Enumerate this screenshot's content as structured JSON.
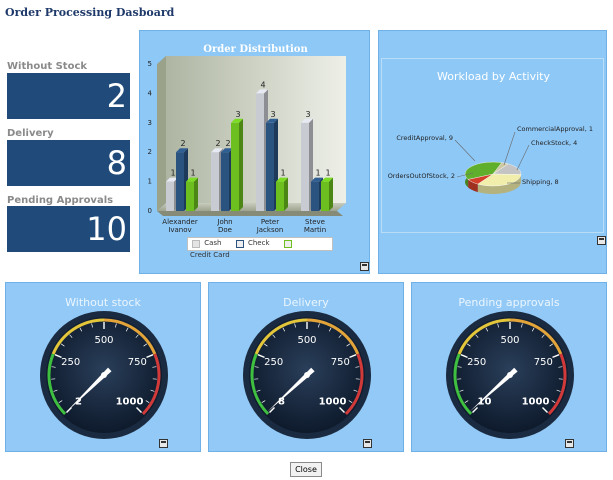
{
  "page": {
    "title": "Order Processing Dasboard"
  },
  "kpis": [
    {
      "label": "Without Stock",
      "value": "2"
    },
    {
      "label": "Delivery",
      "value": "8"
    },
    {
      "label": "Pending Approvals",
      "value": "10"
    }
  ],
  "chart_data": [
    {
      "type": "bar",
      "title": "Order Distribution",
      "categories": [
        "Alexander Ivanov",
        "John Doe",
        "Peter Jackson",
        "Steve Martin"
      ],
      "series": [
        {
          "name": "Cash",
          "values": [
            1,
            2,
            4,
            3
          ],
          "color": "#c9cbd3"
        },
        {
          "name": "Check",
          "values": [
            2,
            2,
            3,
            1
          ],
          "color": "#2a5380"
        },
        {
          "name": "Credit Card",
          "values": [
            1,
            3,
            1,
            1
          ],
          "color": "#6cbf1e"
        }
      ],
      "ylim": [
        0,
        5
      ],
      "yticks": [
        "0",
        "1",
        "2",
        "3",
        "4",
        "5"
      ],
      "legend": "bottom"
    },
    {
      "type": "pie",
      "title": "Workload by Activity",
      "slices": [
        {
          "label": "CommercialApproval",
          "value": 1,
          "color": "#cfc8a4"
        },
        {
          "label": "CheckStock",
          "value": 4,
          "color": "#c4c4c4"
        },
        {
          "label": "Shipping",
          "value": 8,
          "color": "#f0eeaa"
        },
        {
          "label": "OrdersOutOfStock",
          "value": 2,
          "color": "#d2402a"
        },
        {
          "label": "CreditApproval",
          "value": 9,
          "color": "#5fae2c"
        }
      ],
      "slice_labels": [
        "CommercialApproval, 1",
        "CheckStock, 4",
        "Shipping, 8",
        "OrdersOutOfStock, 2",
        "CreditApproval, 9"
      ]
    }
  ],
  "gauges": [
    {
      "title": "Without stock",
      "value": 2,
      "value_label": "2",
      "max": 1000,
      "ticks": [
        "250",
        "500",
        "750",
        "1000"
      ]
    },
    {
      "title": "Delivery",
      "value": 8,
      "value_label": "8",
      "max": 1000,
      "ticks": [
        "250",
        "500",
        "750",
        "1000"
      ]
    },
    {
      "title": "Pending approvals",
      "value": 10,
      "value_label": "10",
      "max": 1000,
      "ticks": [
        "250",
        "500",
        "750",
        "1000"
      ]
    }
  ],
  "footer": {
    "close_label": "Close"
  }
}
